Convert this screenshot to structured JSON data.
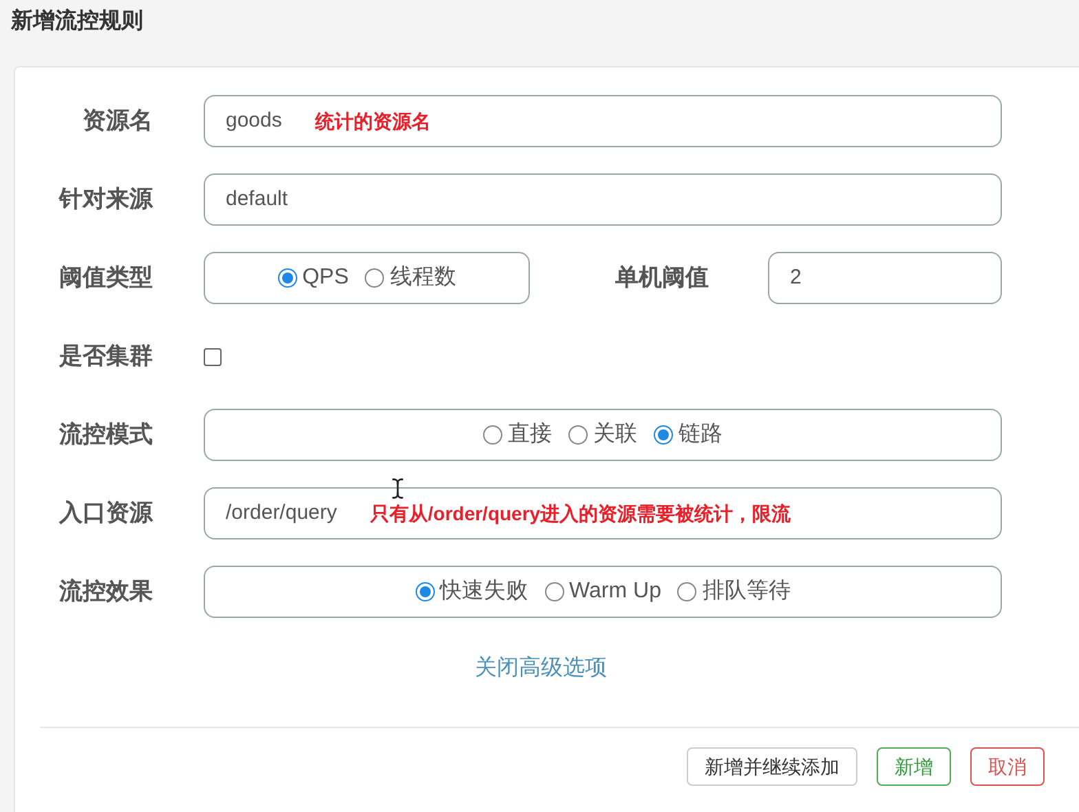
{
  "title": "新增流控规则",
  "fields": [
    {
      "kind": "text",
      "label": "资源名",
      "value": "goods",
      "annotation": "统计的资源名"
    },
    {
      "kind": "text",
      "label": "针对来源",
      "value": "default"
    },
    {
      "kind": "pair",
      "label": "阈值类型",
      "options": [
        {
          "label": "QPS",
          "selected": true
        },
        {
          "label": "线程数",
          "selected": false
        }
      ],
      "second_label": "单机阈值",
      "second_value": "2"
    },
    {
      "kind": "checkbox",
      "label": "是否集群",
      "checked": false
    },
    {
      "kind": "radio",
      "label": "流控模式",
      "options": [
        {
          "label": "直接",
          "selected": false
        },
        {
          "label": "关联",
          "selected": false
        },
        {
          "label": "链路",
          "selected": true
        }
      ]
    },
    {
      "kind": "text",
      "label": "入口资源",
      "value": "/order/query",
      "annotation": "只有从/order/query进入的资源需要被统计，限流",
      "cursor": true
    },
    {
      "kind": "radio",
      "label": "流控效果",
      "options": [
        {
          "label": "快速失败",
          "selected": true
        },
        {
          "label": "Warm Up",
          "selected": false
        },
        {
          "label": "排队等待",
          "selected": false
        }
      ]
    }
  ],
  "advanced_link": "关闭高级选项",
  "buttons": [
    {
      "label": "新增并继续添加",
      "kind": "default"
    },
    {
      "label": "新增",
      "kind": "primary"
    },
    {
      "label": "取消",
      "kind": "danger"
    }
  ]
}
